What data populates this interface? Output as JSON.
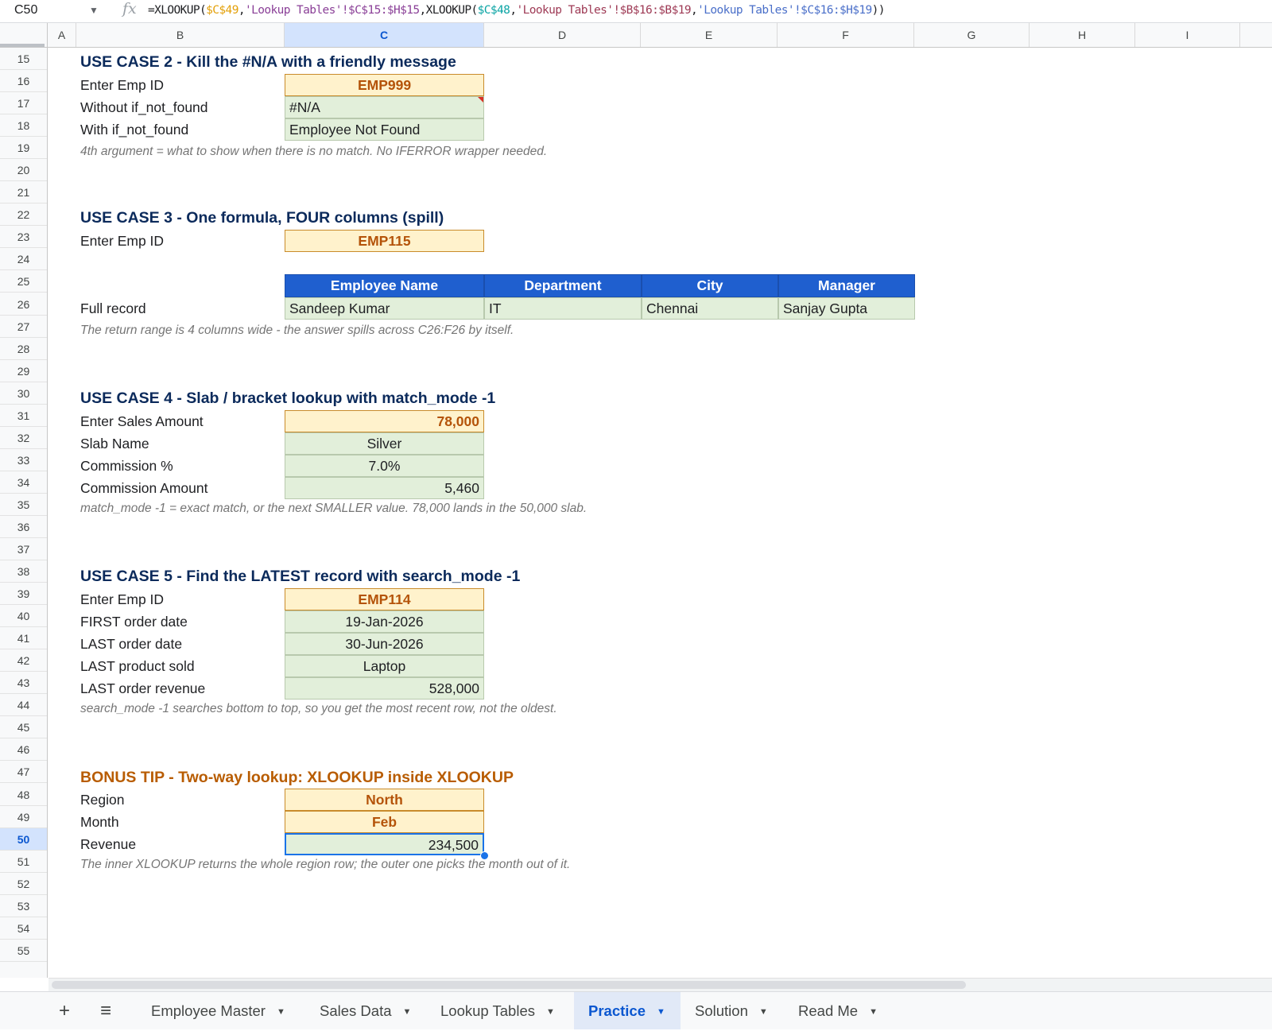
{
  "formula_bar": {
    "name_box": "C50",
    "fx": "fx",
    "formula_parts": [
      {
        "text": "=XLOOKUP(",
        "color": "#202124"
      },
      {
        "text": "$C$49",
        "color": "#e3a008"
      },
      {
        "text": ",",
        "color": "#202124"
      },
      {
        "text": "'Lookup Tables'!$C$15:$H$15",
        "color": "#8a3f97"
      },
      {
        "text": ",XLOOKUP(",
        "color": "#202124"
      },
      {
        "text": "$C$48",
        "color": "#0aa4a4"
      },
      {
        "text": ",",
        "color": "#202124"
      },
      {
        "text": "'Lookup Tables'!$B$16:$B$19",
        "color": "#9e3a55"
      },
      {
        "text": ",",
        "color": "#202124"
      },
      {
        "text": "'Lookup Tables'!$C$16:$H$19",
        "color": "#4a6fc9"
      },
      {
        "text": "))",
        "color": "#202124"
      }
    ]
  },
  "columns": [
    "A",
    "B",
    "C",
    "D",
    "E",
    "F",
    "G",
    "H",
    "I"
  ],
  "rows": [
    "15",
    "16",
    "17",
    "18",
    "19",
    "20",
    "21",
    "22",
    "23",
    "24",
    "25",
    "26",
    "27",
    "28",
    "29",
    "30",
    "31",
    "32",
    "33",
    "34",
    "35",
    "36",
    "37",
    "38",
    "39",
    "40",
    "41",
    "42",
    "43",
    "44",
    "45",
    "46",
    "47",
    "48",
    "49",
    "50",
    "51",
    "52",
    "53",
    "54",
    "55"
  ],
  "use_case_2": {
    "title": "USE CASE 2  -  Kill the #N/A with a friendly message",
    "enter_label": "Enter Emp ID",
    "enter_value": "EMP999",
    "without_label": "Without if_not_found",
    "without_value": "#N/A",
    "with_label": "With if_not_found",
    "with_value": "Employee Not Found",
    "note": "4th argument = what to show when there is no match. No IFERROR wrapper needed."
  },
  "use_case_3": {
    "title": "USE CASE 3  -  One formula, FOUR columns (spill)",
    "enter_label": "Enter Emp ID",
    "enter_value": "EMP115",
    "headers": [
      "Employee Name",
      "Department",
      "City",
      "Manager"
    ],
    "record_label": "Full record",
    "record": [
      "Sandeep Kumar",
      "IT",
      "Chennai",
      "Sanjay Gupta"
    ],
    "note": "The return range is 4 columns wide - the answer spills across C26:F26 by itself."
  },
  "use_case_4": {
    "title": "USE CASE 4  -  Slab / bracket lookup with match_mode -1",
    "enter_label": "Enter Sales Amount",
    "enter_value": "78,000",
    "slab_label": "Slab Name",
    "slab_value": "Silver",
    "pct_label": "Commission %",
    "pct_value": "7.0%",
    "amt_label": "Commission Amount",
    "amt_value": "5,460",
    "note": "match_mode -1 = exact match, or the next SMALLER value. 78,000 lands in the 50,000 slab."
  },
  "use_case_5": {
    "title": "USE CASE 5  -  Find the LATEST record with search_mode -1",
    "enter_label": "Enter Emp ID",
    "enter_value": "EMP114",
    "first_label": "FIRST order date",
    "first_value": "19-Jan-2026",
    "last_label": "LAST order date",
    "last_value": "30-Jun-2026",
    "product_label": "LAST product sold",
    "product_value": "Laptop",
    "revenue_label": "LAST order revenue",
    "revenue_value": "528,000",
    "note": "search_mode -1 searches bottom to top, so you get the most recent row, not the oldest."
  },
  "bonus": {
    "title": "BONUS TIP  -  Two-way lookup: XLOOKUP inside XLOOKUP",
    "region_label": "Region",
    "region_value": "North",
    "month_label": "Month",
    "month_value": "Feb",
    "revenue_label": "Revenue",
    "revenue_value": "234,500",
    "note": "The inner XLOOKUP returns the whole region row; the outer one picks the month out of it."
  },
  "tabs": {
    "add_icon": "+",
    "menu_icon": "≡",
    "items": [
      "Employee Master",
      "Sales Data",
      "Lookup Tables",
      "Practice",
      "Solution",
      "Read Me"
    ],
    "active": "Practice"
  }
}
